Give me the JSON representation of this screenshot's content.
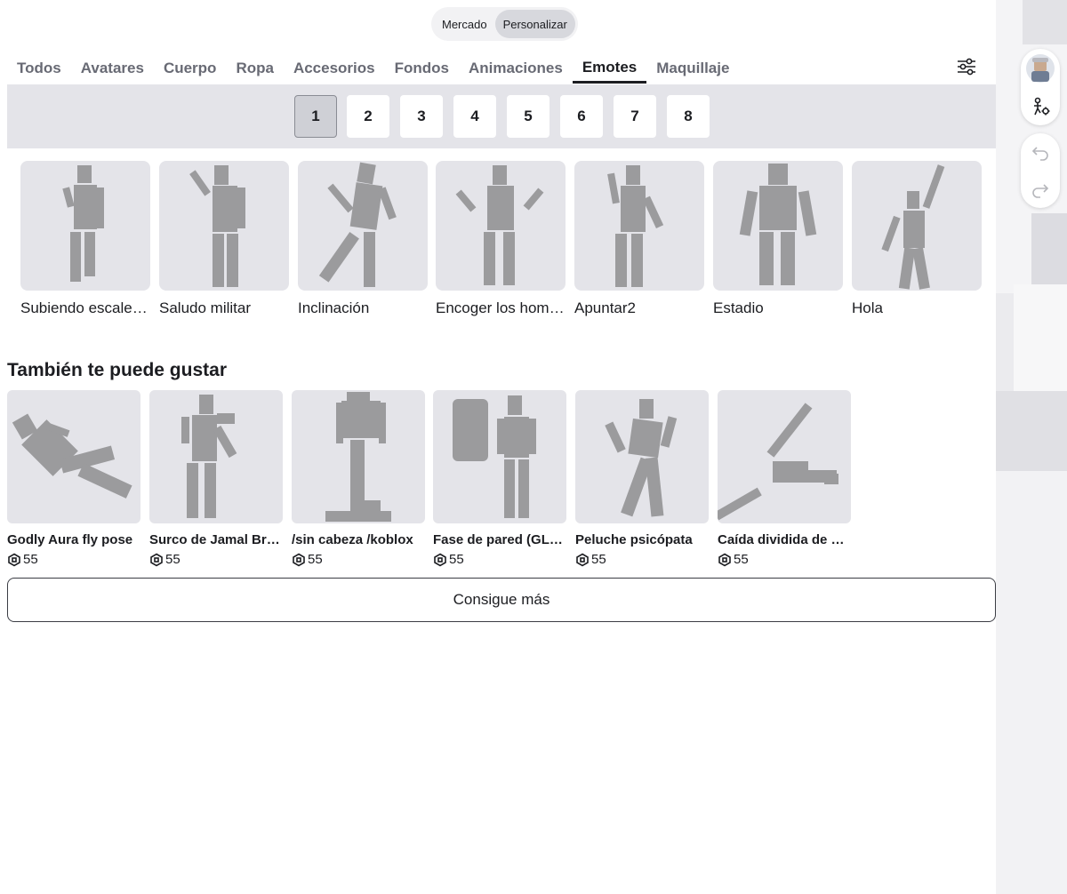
{
  "toggle": {
    "marketplace": "Mercado",
    "customize": "Personalizar"
  },
  "tabs": [
    {
      "label": "Todos"
    },
    {
      "label": "Avatares"
    },
    {
      "label": "Cuerpo"
    },
    {
      "label": "Ropa"
    },
    {
      "label": "Accesorios"
    },
    {
      "label": "Fondos"
    },
    {
      "label": "Animaciones"
    },
    {
      "label": "Emotes"
    },
    {
      "label": "Maquillaje"
    }
  ],
  "active_tab": "Emotes",
  "pages": [
    "1",
    "2",
    "3",
    "4",
    "5",
    "6",
    "7",
    "8"
  ],
  "active_page": "1",
  "emotes": [
    {
      "label": "Subiendo escaleras"
    },
    {
      "label": "Saludo militar"
    },
    {
      "label": "Inclinación"
    },
    {
      "label": "Encoger los hombros"
    },
    {
      "label": "Apuntar2"
    },
    {
      "label": "Estadio"
    },
    {
      "label": "Hola"
    }
  ],
  "recommendations": {
    "title": "También te puede gustar",
    "items": [
      {
        "name": "Godly Aura fly pose",
        "price": "55"
      },
      {
        "name": "Surco de Jamal Brazil",
        "price": "55"
      },
      {
        "name": "/sin cabeza /koblox",
        "price": "55"
      },
      {
        "name": "Fase de pared (GLITCH)",
        "price": "55"
      },
      {
        "name": "Peluche psicópata",
        "price": "55"
      },
      {
        "name": "Caída dividida de arriba",
        "price": "55"
      }
    ]
  },
  "get_more": "Consigue más",
  "icons": {
    "filter": "sliders-icon",
    "avatar": "avatar-icon",
    "avatar_settings": "avatar-settings-icon",
    "undo": "undo-icon",
    "redo": "redo-icon",
    "robux": "robux-icon"
  },
  "colors": {
    "thumb_bg": "#e4e4e9",
    "figure": "#9b9b9d",
    "text": "#1c1d21",
    "tab_muted": "#686a74"
  }
}
